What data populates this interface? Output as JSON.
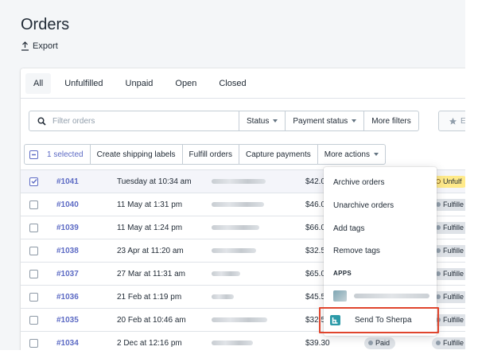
{
  "page": {
    "title": "Orders",
    "export_label": "Export"
  },
  "tabs": [
    {
      "label": "All",
      "active": true
    },
    {
      "label": "Unfulfilled",
      "active": false
    },
    {
      "label": "Unpaid",
      "active": false
    },
    {
      "label": "Open",
      "active": false
    },
    {
      "label": "Closed",
      "active": false
    }
  ],
  "filters": {
    "search_placeholder": "Filter orders",
    "status_label": "Status",
    "payment_status_label": "Payment status",
    "more_filters_label": "More filters",
    "saved_partial_label": "E"
  },
  "bulk": {
    "selected_label": "1 selected",
    "create_shipping_labels": "Create shipping labels",
    "fulfill_orders": "Fulfill orders",
    "capture_payments": "Capture payments",
    "more_actions": "More actions"
  },
  "orders": [
    {
      "number": "#1041",
      "date": "Tuesday at 10:34 am",
      "amount": "$42.0",
      "fulfillment": "Unfulf",
      "selected": true
    },
    {
      "number": "#1040",
      "date": "11 May at 1:31 pm",
      "amount": "$46.0",
      "fulfillment": "Fulfille",
      "selected": false
    },
    {
      "number": "#1039",
      "date": "11 May at 1:24 pm",
      "amount": "$66.0",
      "fulfillment": "Fulfille",
      "selected": false
    },
    {
      "number": "#1038",
      "date": "23 Apr at 11:20 am",
      "amount": "$32.5",
      "fulfillment": "Fulfille",
      "selected": false
    },
    {
      "number": "#1037",
      "date": "27 Mar at 11:31 am",
      "amount": "$65.0",
      "fulfillment": "Fulfille",
      "selected": false
    },
    {
      "number": "#1036",
      "date": "21 Feb at 1:19 pm",
      "amount": "$45.5",
      "fulfillment": "Fulfille",
      "selected": false
    },
    {
      "number": "#1035",
      "date": "20 Feb at 10:46 am",
      "amount": "$32.5",
      "fulfillment": "Fulfille",
      "selected": false
    },
    {
      "number": "#1034",
      "date": "2 Dec at 12:16 pm",
      "amount": "$39.30",
      "payment": "Paid",
      "fulfillment": "Fulfille",
      "selected": false
    }
  ],
  "more_actions_menu": {
    "items": [
      "Archive orders",
      "Unarchive orders",
      "Add tags",
      "Remove tags"
    ],
    "apps_heading": "APPS",
    "sherpa_label": "Send To Sherpa"
  },
  "colors": {
    "accent": "#5c6ac4",
    "highlight_border": "#e0452d",
    "sherpa_icon": "#2c9aa8",
    "unfulfilled_badge": "#ffea8a"
  }
}
